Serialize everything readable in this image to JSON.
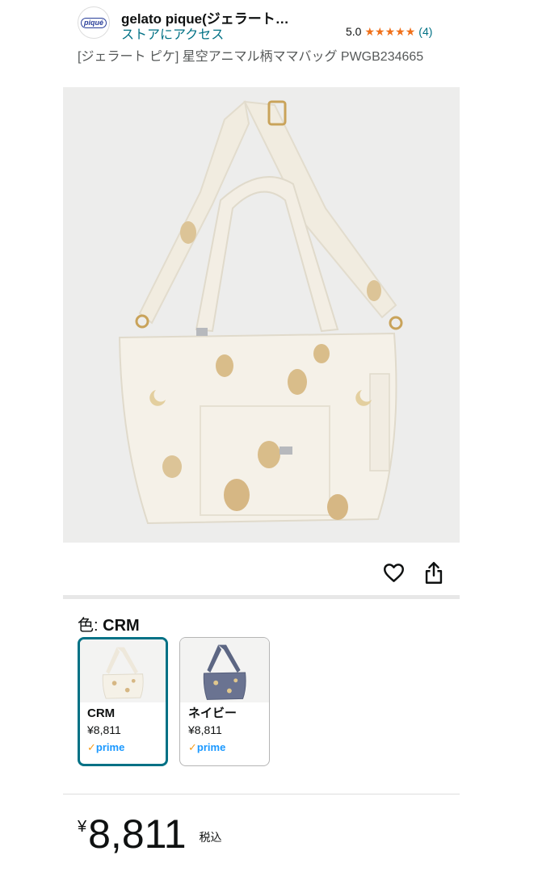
{
  "store": {
    "logo_text": "piqué",
    "name": "gelato pique(ジェラート…",
    "link_label": "ストアにアクセス",
    "rating_value": "5.0",
    "rating_stars": 5,
    "rating_count": "(4)"
  },
  "product": {
    "title": "[ジェラート ピケ] 星空アニマル柄ママバッグ PWGB234665"
  },
  "icons": {
    "favorite": "heart-icon",
    "share": "share-icon"
  },
  "color_selector": {
    "label": "色: ",
    "selected_value": "CRM",
    "options": [
      {
        "name": "CRM",
        "price": "¥8,811",
        "badge": "prime",
        "selected": true
      },
      {
        "name": "ネイビー",
        "price": "¥8,811",
        "badge": "prime",
        "selected": false
      }
    ]
  },
  "price": {
    "currency": "¥",
    "amount": "8,811",
    "tax_label": "税込"
  },
  "colors": {
    "link": "#007185",
    "star": "#f0701a",
    "prime": "#1a98ff",
    "selected_border": "#007185"
  }
}
